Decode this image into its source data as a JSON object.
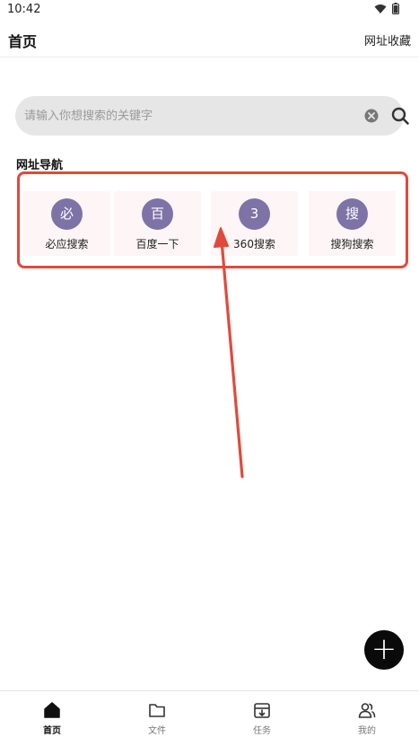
{
  "status_bar": {
    "time": "10:42",
    "icons": [
      "wifi-icon",
      "battery-icon"
    ]
  },
  "header": {
    "title": "首页",
    "bookmarks_label": "网址收藏"
  },
  "search": {
    "placeholder": "请输入你想搜索的关键字",
    "value": "",
    "icons": [
      "clear-icon",
      "search-icon"
    ]
  },
  "section": {
    "title": "网址导航"
  },
  "nav_items": [
    {
      "glyph": "必",
      "label": "必应搜索"
    },
    {
      "glyph": "百",
      "label": "百度一下"
    },
    {
      "glyph": "3",
      "label": "360搜索"
    },
    {
      "glyph": "搜",
      "label": "搜狗搜索"
    }
  ],
  "fab": {
    "icon": "plus-icon",
    "glyph": "+"
  },
  "bottom_nav": [
    {
      "label": "首页",
      "icon": "home-icon",
      "active": true
    },
    {
      "label": "文件",
      "icon": "folder-icon",
      "active": false
    },
    {
      "label": "任务",
      "icon": "download-box-icon",
      "active": false
    },
    {
      "label": "我的",
      "icon": "users-icon",
      "active": false
    }
  ],
  "colors": {
    "accent_circle": "#7d73a6",
    "tile_background": "#fdf5f6",
    "annotation": "#e14a3b",
    "search_background": "#e6e6e6"
  }
}
